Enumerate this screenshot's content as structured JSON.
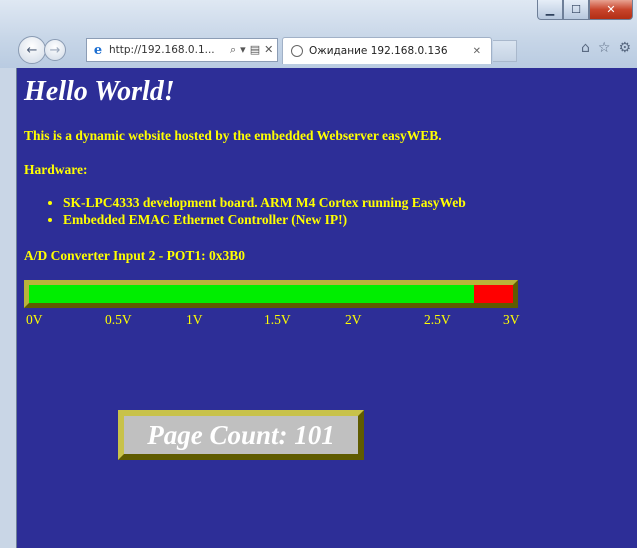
{
  "browser": {
    "address_url": "http://192.168.0.1...",
    "tab_title": "Ожидание 192.168.0.136",
    "close_tab": "✕",
    "window_buttons": {
      "minimize": "▁",
      "maximize": "☐",
      "close": "✕"
    },
    "icons": [
      "back-icon",
      "forward-icon",
      "ie-logo-icon",
      "search-icon",
      "compat-view-icon",
      "stop-icon",
      "home-icon",
      "favorites-star-icon",
      "gear-icon"
    ]
  },
  "page": {
    "heading": "Hello World!",
    "intro": "This is a dynamic website hosted by the embedded Webserver easyWEB.",
    "hardware_label": "Hardware:",
    "hardware_items": [
      "SK-LPC4333 development board. ARM M4 Cortex running EasyWeb",
      "Embedded EMAC Ethernet Controller (New IP!)"
    ],
    "adc_label": "A/D Converter Input 2 - POT1: 0x3B0",
    "adc_fill_fraction": 0.92,
    "scale_labels": [
      "0V",
      "0.5V",
      "1V",
      "1.5V",
      "2V",
      "2.5V",
      "3V"
    ],
    "page_count": "Page Count: 101"
  },
  "colors": {
    "background": "#2d2e97",
    "text": "#ffff00",
    "heading": "#ffffff",
    "bar_fill": "#00ee00",
    "bar_empty": "#ff0000",
    "frame": "#8b8600"
  }
}
